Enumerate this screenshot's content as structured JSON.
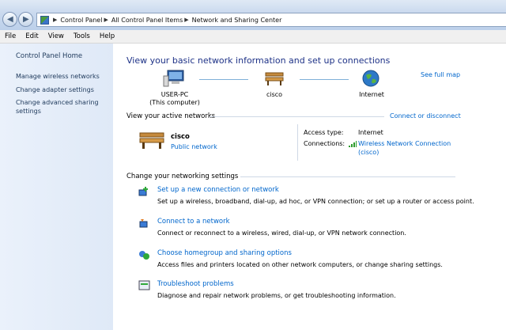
{
  "window": {
    "breadcrumbs": [
      "Control Panel",
      "All Control Panel Items",
      "Network and Sharing Center"
    ]
  },
  "menu": [
    "File",
    "Edit",
    "View",
    "Tools",
    "Help"
  ],
  "sidebar": {
    "home": "Control Panel Home",
    "links": [
      "Manage wireless networks",
      "Change adapter settings",
      "Change advanced sharing settings"
    ]
  },
  "main": {
    "heading": "View your basic network information and set up connections",
    "see_full_map": "See full map",
    "map": {
      "computer_name": "USER-PC",
      "computer_sub": "(This computer)",
      "network": "cisco",
      "internet": "Internet"
    },
    "active": {
      "title": "View your active networks",
      "connect_link": "Connect or disconnect",
      "network_name": "cisco",
      "network_type": "Public network",
      "access_type_label": "Access type:",
      "access_type_value": "Internet",
      "connections_label": "Connections:",
      "connection_value": "Wireless Network Connection",
      "connection_sub": "(cisco)"
    },
    "settings": {
      "title": "Change your networking settings",
      "tasks": [
        {
          "title": "Set up a new connection or network",
          "desc": "Set up a wireless, broadband, dial-up, ad hoc, or VPN connection; or set up a router or access point."
        },
        {
          "title": "Connect to a network",
          "desc": "Connect or reconnect to a wireless, wired, dial-up, or VPN network connection."
        },
        {
          "title": "Choose homegroup and sharing options",
          "desc": "Access files and printers located on other network computers, or change sharing settings."
        },
        {
          "title": "Troubleshoot problems",
          "desc": "Diagnose and repair network problems, or get troubleshooting information."
        }
      ]
    }
  }
}
